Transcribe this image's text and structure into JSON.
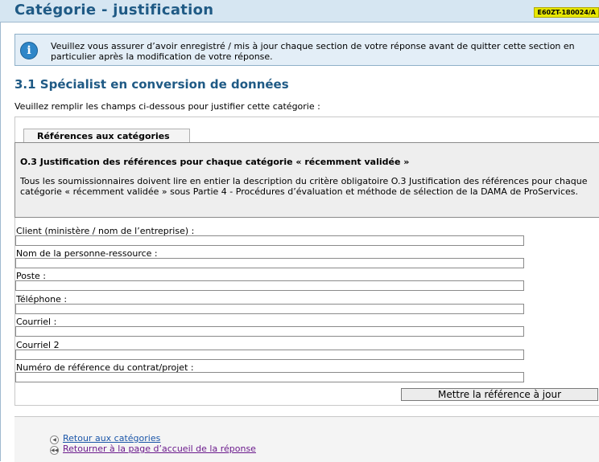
{
  "header": {
    "title": "Catégorie - justification",
    "badge": "E60ZT-180024/A"
  },
  "info": {
    "icon": "info-icon",
    "text": "Veuillez vous assurer d’avoir enregistré / mis à jour chaque section de votre réponse avant de quitter cette section en particulier après la modification de votre réponse."
  },
  "section": {
    "title": "3.1 Spécialist en conversion de données",
    "instruction": "Veuillez remplir les champs ci-dessous pour justifier cette catégorie :"
  },
  "tab": {
    "label": "Références aux catégories"
  },
  "panel": {
    "title": "O.3 Justification des références pour chaque catégorie « récemment validée »",
    "body": "Tous les soumissionnaires doivent lire en entier la description du critère obligatoire O.3 Justification des références pour chaque catégorie « récemment validée » sous Partie 4 - Procédures d’évaluation et méthode de sélection de la DAMA de ProServices."
  },
  "fields": [
    {
      "label": "Client (ministère / nom de l’entreprise) :",
      "value": ""
    },
    {
      "label": "Nom de la personne-ressource :",
      "value": ""
    },
    {
      "label": "Poste :",
      "value": ""
    },
    {
      "label": "Téléphone :",
      "value": ""
    },
    {
      "label": "Courriel :",
      "value": ""
    },
    {
      "label": "Courriel 2",
      "value": ""
    },
    {
      "label": "Numéro de référence du contrat/projet :",
      "value": ""
    }
  ],
  "actions": {
    "update_label": "Mettre la référence à jour"
  },
  "footer": {
    "back_to_categories": "Retour aux catégories",
    "back_to_home": "Retourner à la page d’accueil de la réponse"
  },
  "colors": {
    "title_blue": "#1f5a85",
    "badge_yellow": "#e8e800",
    "link_blue": "#1a55a8",
    "link_visited": "#6b1a8c"
  }
}
